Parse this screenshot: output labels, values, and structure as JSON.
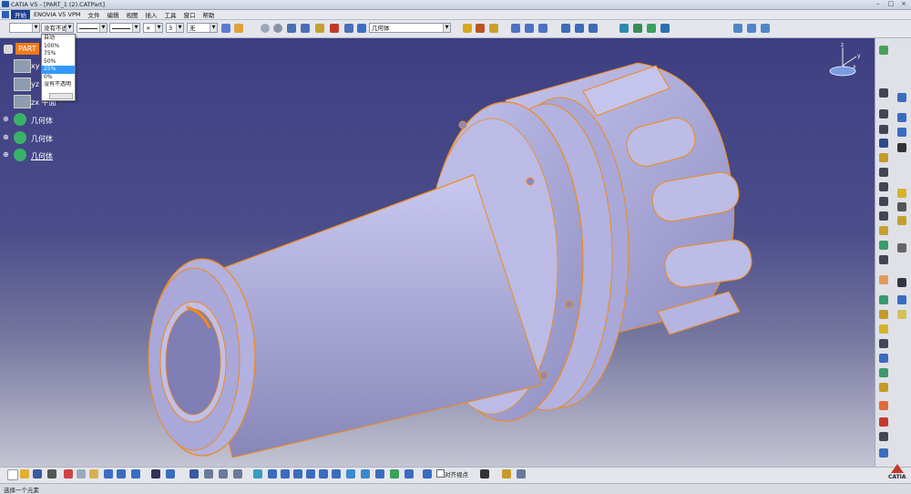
{
  "window": {
    "title": "CATIA V5 - [PART_1 (2).CATPart]",
    "buttons": [
      "–",
      "□",
      "×"
    ]
  },
  "menu": {
    "items": [
      "开始",
      "ENOVIA V5 VPM",
      "文件",
      "编辑",
      "视图",
      "插入",
      "工具",
      "窗口",
      "帮助"
    ]
  },
  "toolbar_top": {
    "transparency_value": "没有不透",
    "line_type_value": "",
    "line_weight_value": "",
    "point_symbol_value": "×",
    "line_thickness_value": "3",
    "layer_value": "无",
    "geometry_set_value": "几何体"
  },
  "transparency_dropdown": {
    "options": [
      "自动",
      "100%",
      "75%",
      "50%",
      "25%",
      "0%",
      "没有不透明"
    ],
    "selected": "25%"
  },
  "tree": {
    "root": "PART",
    "planes": [
      "xy",
      "yz",
      "zx 平面"
    ],
    "bodies": [
      "几何体",
      "几何体",
      "几何体"
    ]
  },
  "compass": {
    "axes": [
      "z",
      "y",
      "x"
    ]
  },
  "bottom_toolbar": {
    "snap_label": "对齐视点"
  },
  "status": {
    "text": "选择一个元素"
  },
  "logo": "CATIA",
  "colors": {
    "edge_highlight": "#f08a1a",
    "part_fill": "#b7b6e3",
    "background_top": "#3d3f82",
    "background_bottom": "#c4c4d4",
    "menu_active": "#1c3f8f"
  }
}
